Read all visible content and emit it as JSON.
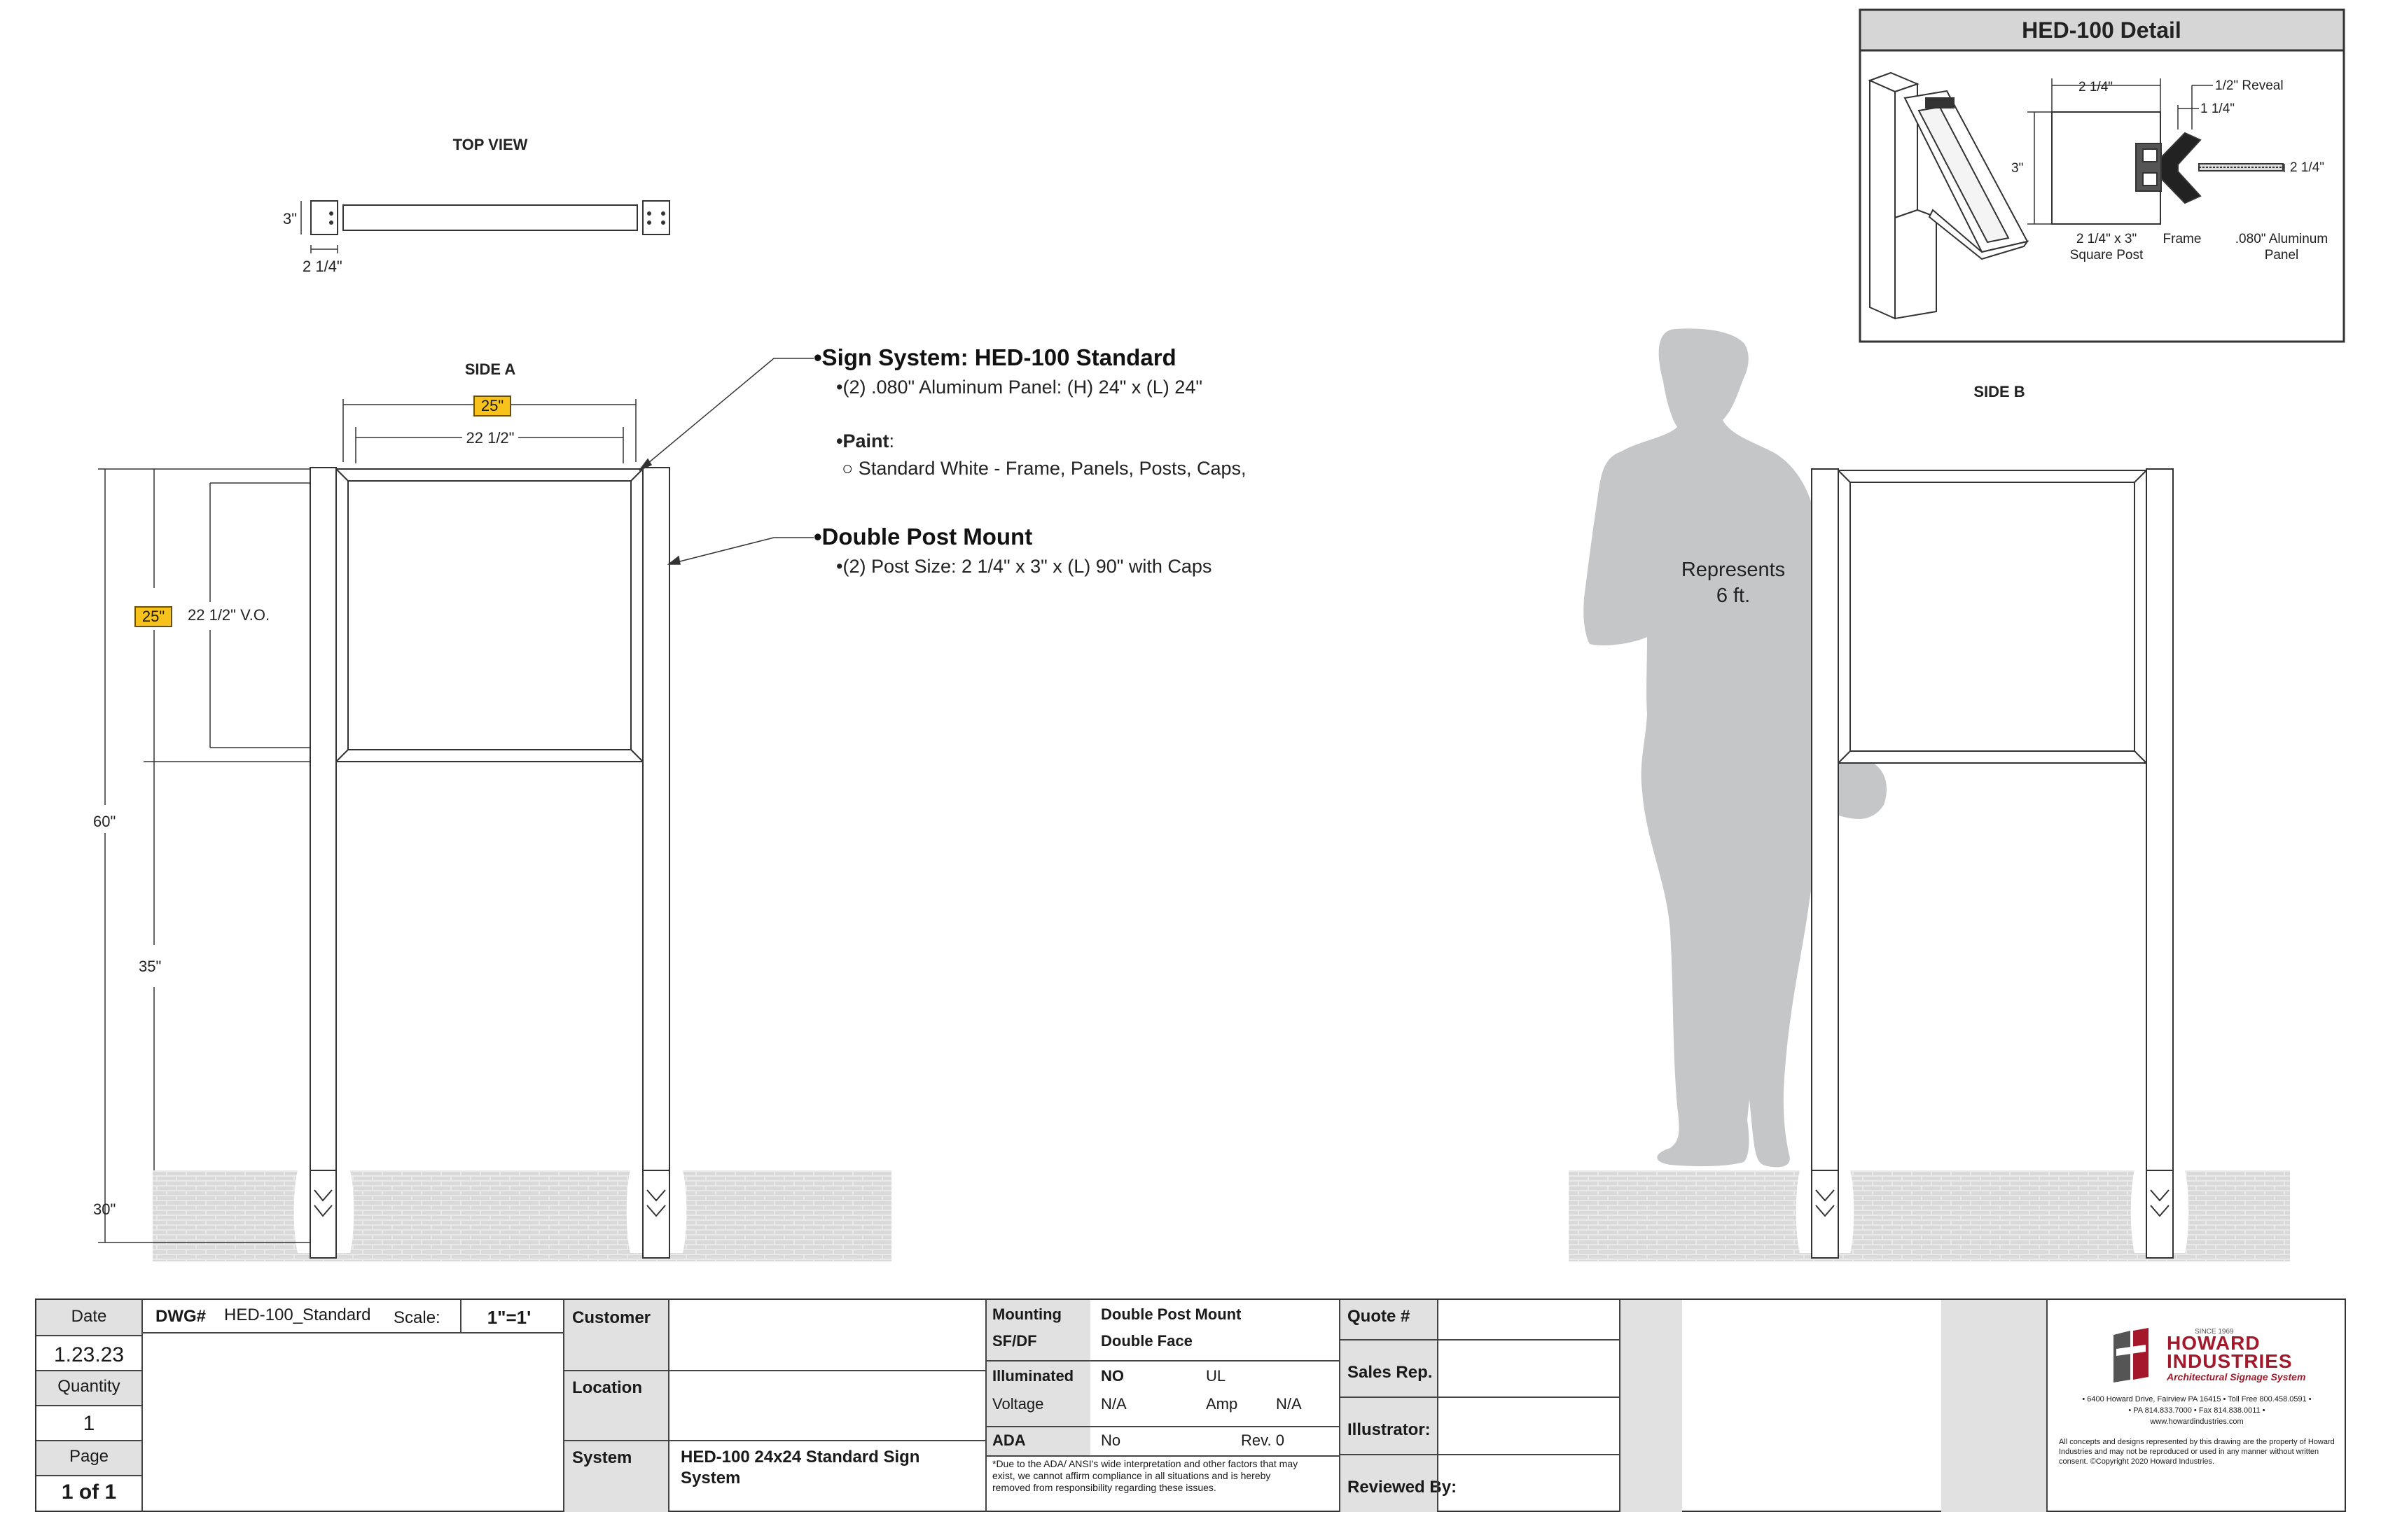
{
  "views": {
    "top": "TOP VIEW",
    "side_a": "SIDE A",
    "side_b": "SIDE B"
  },
  "dims": {
    "top_post_h": "3\"",
    "top_post_w": "2 1/4\"",
    "panel_overall": "25\"",
    "panel_vo": "22 1/2\"",
    "panel_h_overall": "25\"",
    "panel_h_vo": "22 1/2\"  V.O.",
    "total_h": "60\"",
    "post_to_panel": "35\"",
    "embed": "30\""
  },
  "callouts": {
    "sign_system": "•Sign System: HED-100 Standard",
    "panel_spec": "•(2) .080\" Aluminum Panel: (H) 24\" x (L) 24\"",
    "paint_label": "•Paint",
    "paint_colon": ":",
    "paint_option": "○ Standard White - Frame, Panels, Posts, Caps,",
    "mount": "•Double Post Mount",
    "post_spec": "•(2) Post Size: 2 1/4\" x 3\" x (L) 90\" with Caps"
  },
  "person": {
    "line1": "Represents",
    "line2": "6 ft."
  },
  "detail": {
    "title": "HED-100 Detail",
    "d_width": "2 1/4\"",
    "d_reveal": "1/2\" Reveal",
    "d_114": "1 1/4\"",
    "d_3": "3\"",
    "d_right": "2 1/4\"",
    "lbl_post1": "2 1/4\" x 3\"",
    "lbl_post2": "Square Post",
    "lbl_frame": "Frame",
    "lbl_panel1": ".080\" Aluminum",
    "lbl_panel2": "Panel"
  },
  "titleblock": {
    "date_label": "Date",
    "date": "1.23.23",
    "quantity_label": "Quantity",
    "quantity": "1",
    "page_label": "Page",
    "page": "1 of 1",
    "dwg_label": "DWG#",
    "dwg": "HED-100_Standard",
    "scale_label": "Scale:",
    "scale": "1\"=1'",
    "customer_label": "Customer",
    "customer": "",
    "location_label": "Location",
    "location": "",
    "system_label": "System",
    "system": "HED-100 24x24 Standard Sign System",
    "mounting_label": "Mounting",
    "mounting": "Double Post Mount",
    "sfdf_label": "SF/DF",
    "sfdf": "Double Face",
    "illuminated_label": "Illuminated",
    "illuminated": "NO",
    "ul_label": "UL",
    "voltage_label": "Voltage",
    "voltage": "N/A",
    "amp_label": "Amp",
    "amp": "N/A",
    "ada_label": "ADA",
    "ada": "No",
    "rev": "Rev. 0",
    "ada_note": "*Due to the ADA/ ANSI's wide interpretation and other factors that may exist, we cannot affirm compliance in all situations and is hereby removed from responsibility regarding these issues.",
    "quote_label": "Quote #",
    "quote": "",
    "salesrep_label": "Sales Rep.",
    "salesrep": "",
    "illustrator_label": "Illustrator:",
    "illustrator": "",
    "reviewed_label": "Reviewed By:",
    "reviewed": ""
  },
  "company": {
    "since": "SINCE 1969",
    "name1": "HOWARD",
    "name2": "INDUSTRIES",
    "tagline": "Architectural Signage Systems",
    "addr1": "• 6400 Howard Drive, Fairview PA 16415 • Toll Free 800.458.0591 •",
    "addr2": "• PA 814.833.7000 • Fax 814.838.0011 •",
    "addr3": "www.howardindustries.com",
    "legal": "All concepts and designs represented by this drawing are the property of Howard Industries and may not be reproduced or used in any manner without written consent. ©Copyright 2020 Howard Industries.",
    "brand_color": "#a3182a"
  },
  "colors": {
    "dim_highlight": "#f6c21b",
    "silhouette": "#c4c6c8",
    "ground": "#e7e7e7"
  }
}
